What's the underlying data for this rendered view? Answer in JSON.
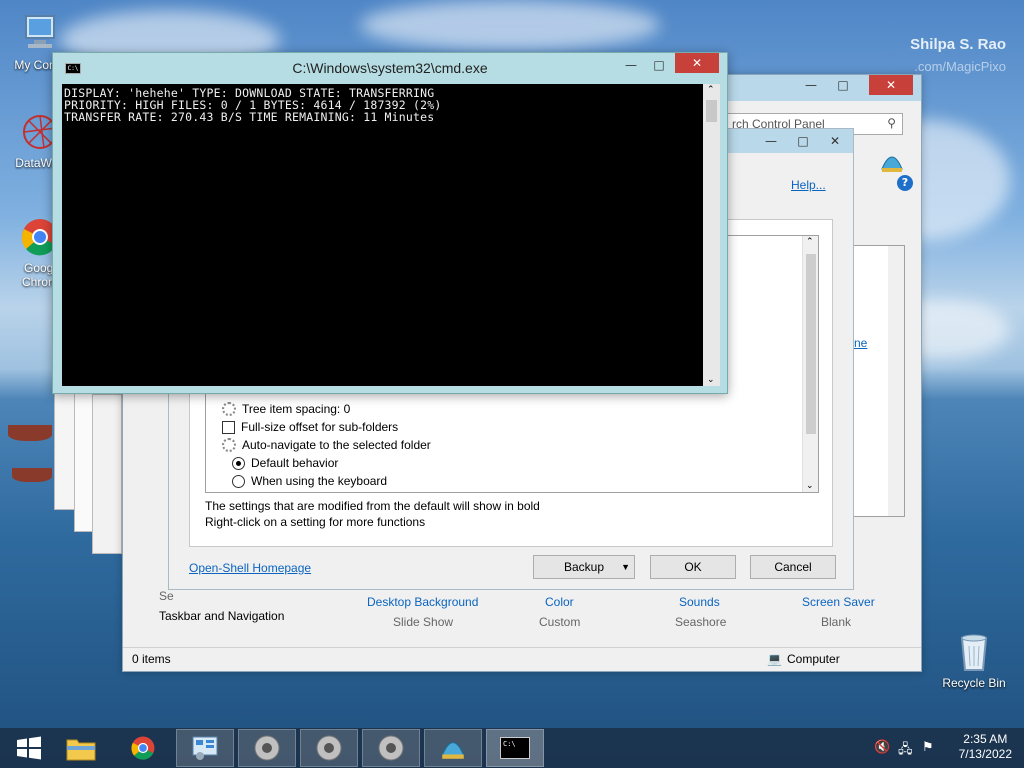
{
  "watermark": {
    "name": "Shilpa S. Rao",
    "site": ".com/MagicPixo"
  },
  "desktop_icons": [
    {
      "label": "My Comp"
    },
    {
      "label": "DataWag"
    },
    {
      "label_line1": "Googl",
      "label_line2": "Chrom"
    },
    {
      "label": "Recycle Bin"
    }
  ],
  "cmd": {
    "title": "C:\\Windows\\system32\\cmd.exe",
    "icon_label": "C:\\",
    "lines": [
      "DISPLAY: 'hehehe' TYPE: DOWNLOAD STATE: TRANSFERRING",
      "PRIORITY: HIGH FILES: 0 / 1 BYTES: 4614 / 187392 (2%)",
      "TRANSFER RATE: 270.43 B/S TIME REMAINING: 11 Minutes"
    ]
  },
  "control_panel": {
    "search_placeholder": "rch Control Panel",
    "help_text": "Help...",
    "partial_link": "ne",
    "left_label_partial": "Se",
    "left_label": "Taskbar and Navigation",
    "personalize": [
      {
        "title": "Desktop Background",
        "value": "Slide Show"
      },
      {
        "title": "Color",
        "value": "Custom"
      },
      {
        "title": "Sounds",
        "value": "Seashore"
      },
      {
        "title": "Screen Saver",
        "value": "Blank"
      }
    ],
    "status_items": "0 items",
    "status_location": "Computer"
  },
  "settings": {
    "rows": [
      {
        "type": "gear",
        "label": "Tree item spacing: 0"
      },
      {
        "type": "checkbox",
        "label": "Full-size offset for sub-folders"
      },
      {
        "type": "gear",
        "label": "Auto-navigate to the selected folder"
      },
      {
        "type": "radio-on",
        "label": "Default behavior"
      },
      {
        "type": "radio",
        "label": "When using the keyboard"
      }
    ],
    "note_line1": "The settings that are modified from the default will show in bold",
    "note_line2": "Right-click on a setting for more functions",
    "homepage_link": "Open-Shell Homepage",
    "backup_label": "Backup",
    "ok_label": "OK",
    "cancel_label": "Cancel"
  },
  "taskbar": {
    "time": "2:35 AM",
    "date": "7/13/2022"
  },
  "colors": {
    "cmd_frame": "#b6dde3",
    "close_button": "#c7403a",
    "link": "#0b64c0"
  }
}
